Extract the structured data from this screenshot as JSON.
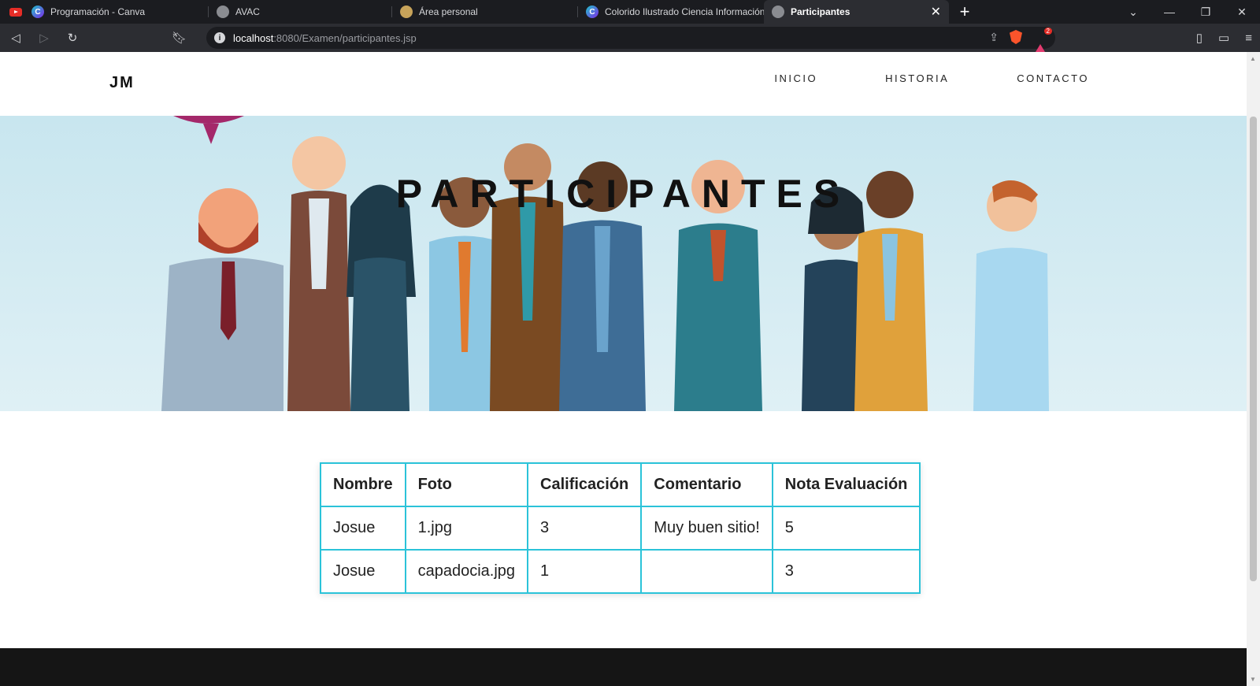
{
  "browser": {
    "tabs": [
      {
        "title": "Programación - Canva",
        "icon": "canva-icon",
        "active": false
      },
      {
        "title": "AVAC",
        "icon": "globe-icon",
        "active": false
      },
      {
        "title": "Área personal",
        "icon": "moodle-icon",
        "active": false
      },
      {
        "title": "Colorido Ilustrado Ciencia Información",
        "icon": "canva-icon",
        "active": false
      },
      {
        "title": "Participantes",
        "icon": "globe-icon",
        "active": true
      }
    ],
    "url_host": "localhost",
    "url_path": ":8080/Examen/participantes.jsp",
    "rewards_badge": "2"
  },
  "site": {
    "logo": "JM",
    "nav": [
      "INICIO",
      "HISTORIA",
      "CONTACTO"
    ],
    "hero_title": "PARTICIPANTES"
  },
  "table": {
    "headers": [
      "Nombre",
      "Foto",
      "Calificación",
      "Comentario",
      "Nota Evaluación"
    ],
    "rows": [
      [
        "Josue",
        "1.jpg",
        "3",
        "Muy buen sitio!",
        "5"
      ],
      [
        "Josue",
        "capadocia.jpg",
        "1",
        "",
        "3"
      ]
    ]
  },
  "colors": {
    "table_border": "#2bc3d9",
    "hero_background": "#c8e6ef",
    "footer": "#151515"
  }
}
